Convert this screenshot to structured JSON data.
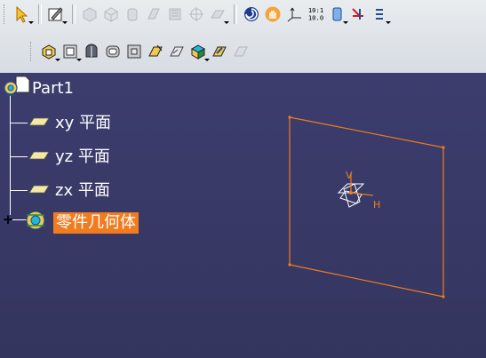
{
  "toolbar": {
    "row1": [
      {
        "name": "select-icon",
        "enabled": true
      },
      {
        "name": "sketcher-icon",
        "enabled": true
      },
      {
        "name": "pad-icon",
        "enabled": false
      },
      {
        "name": "revolve-icon",
        "enabled": false
      },
      {
        "name": "cylinder-icon",
        "enabled": false
      },
      {
        "name": "rib-icon",
        "enabled": false
      },
      {
        "name": "surface-icon",
        "enabled": false
      },
      {
        "name": "grid-icon",
        "enabled": false
      },
      {
        "name": "plane-tool-icon",
        "enabled": false
      },
      {
        "name": "swirl-icon",
        "enabled": true
      },
      {
        "name": "pan-hand-icon",
        "enabled": true
      },
      {
        "name": "axis-system-icon",
        "enabled": true
      },
      {
        "name": "measure-icon",
        "enabled": true
      },
      {
        "name": "geometric-set-icon",
        "enabled": true
      },
      {
        "name": "constraint-icon",
        "enabled": true
      },
      {
        "name": "stack-icon",
        "enabled": true
      }
    ],
    "measure_text_top": "10:1",
    "measure_text_bottom": "10.0",
    "row2": [
      {
        "name": "pocket-icon",
        "enabled": true
      },
      {
        "name": "frame-icon",
        "enabled": true
      },
      {
        "name": "solid-icon",
        "enabled": true
      },
      {
        "name": "shell-icon",
        "enabled": true
      },
      {
        "name": "thickness-icon",
        "enabled": true
      },
      {
        "name": "draft-icon",
        "enabled": true
      },
      {
        "name": "feature-icon",
        "enabled": true
      },
      {
        "name": "cube-icon",
        "enabled": true
      },
      {
        "name": "apply-material-icon",
        "enabled": true
      },
      {
        "name": "refresh-icon",
        "enabled": false
      }
    ]
  },
  "tree": {
    "root": "Part1",
    "planes": [
      {
        "label": "xy 平面"
      },
      {
        "label": "yz 平面"
      },
      {
        "label": "zx 平面"
      }
    ],
    "body": "零件几何体",
    "expand_symbol": "+"
  },
  "viewport": {
    "plane_color": "#f07c1f",
    "axis_v_label": "V",
    "axis_h_label": "H",
    "selection_color": "#f07c1f"
  }
}
